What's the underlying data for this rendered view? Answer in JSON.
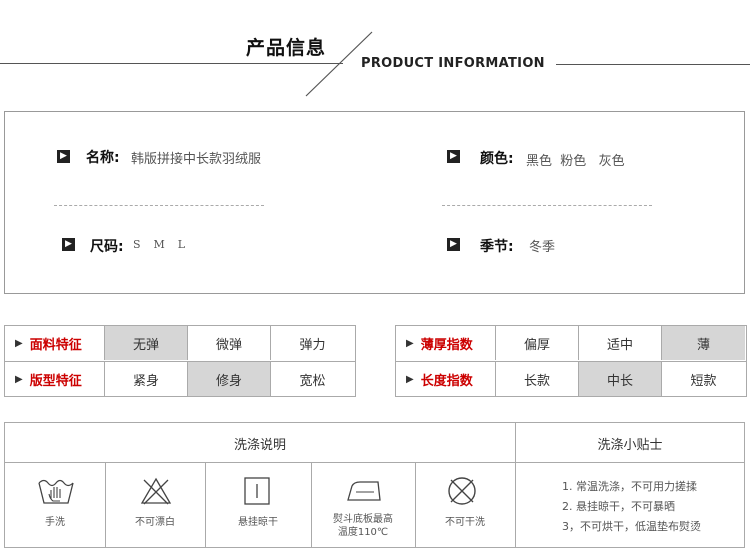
{
  "header": {
    "title_cn": "产品信息",
    "title_en": "PRODUCT INFORMATION"
  },
  "info": {
    "name_label": "名称:",
    "name_value": "韩版拼接中长款羽绒服",
    "color_label": "颜色:",
    "color_value": "黑色  粉色   灰色",
    "size_label": "尺码:",
    "size_value": "S  M  L",
    "season_label": "季节:",
    "season_value": "冬季"
  },
  "attributes_left": [
    {
      "label": "面料特征",
      "options": [
        "无弹",
        "微弹",
        "弹力"
      ],
      "selected": 0
    },
    {
      "label": "版型特征",
      "options": [
        "紧身",
        "修身",
        "宽松"
      ],
      "selected": 1
    }
  ],
  "attributes_right": [
    {
      "label": "薄厚指数",
      "options": [
        "偏厚",
        "适中",
        "薄"
      ],
      "selected": 2
    },
    {
      "label": "长度指数",
      "options": [
        "长款",
        "中长",
        "短款"
      ],
      "selected": 1
    }
  ],
  "wash": {
    "title": "洗涤说明",
    "tips_title": "洗涤小贴士",
    "items": [
      {
        "icon": "hand-wash-icon",
        "label": "手洗"
      },
      {
        "icon": "no-bleach-icon",
        "label": "不可漂白"
      },
      {
        "icon": "hang-dry-icon",
        "label": "悬挂晾干"
      },
      {
        "icon": "iron-icon",
        "label": "熨斗底板最高",
        "label2": "温度110℃"
      },
      {
        "icon": "no-tumble-dry-icon",
        "label": "不可干洗"
      }
    ],
    "tips": [
      "1. 常温洗涤，不可用力搓揉",
      "2. 悬挂晾干，不可暴晒",
      "3，不可烘干，低温垫布熨烫"
    ]
  },
  "colors": {
    "accent_red": "#cc0000",
    "selected_cell": "#d6d6d6",
    "border": "#aaaaaa"
  }
}
